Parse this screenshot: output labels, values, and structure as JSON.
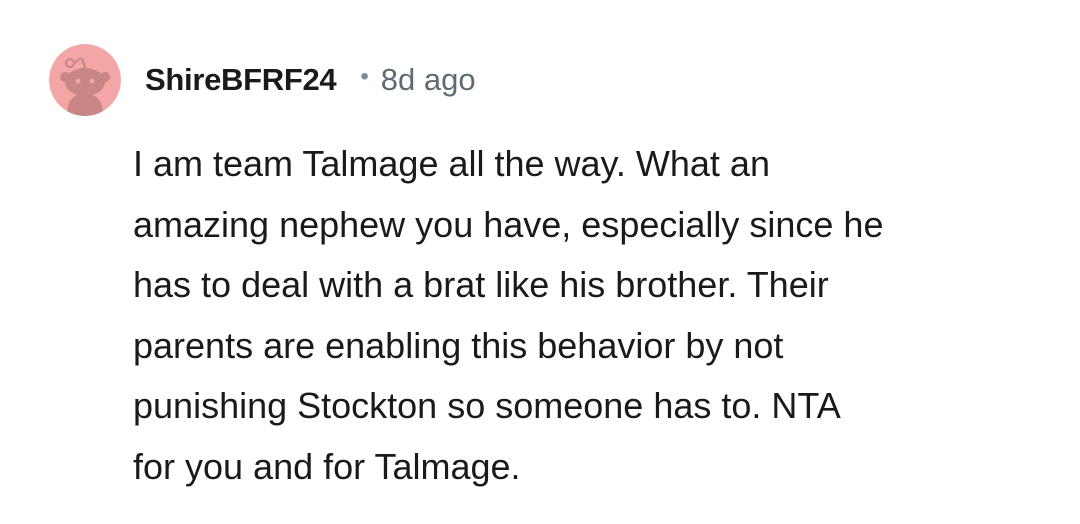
{
  "comment": {
    "author": "ShireBFRF24",
    "separator": "•",
    "timestamp": "8d ago",
    "avatar_icon": "reddit-snoo-avatar-icon",
    "avatar_bg": "#f4a6a6",
    "avatar_fg": "#c98686",
    "body_lines": [
      "I am team Talmage all the way. What an",
      "amazing nephew you have, especially since he",
      "has to deal with a brat like his brother. Their",
      "parents are enabling this behavior by not",
      "punishing Stockton so someone has to. NTA",
      "for you and for Talmage."
    ]
  }
}
